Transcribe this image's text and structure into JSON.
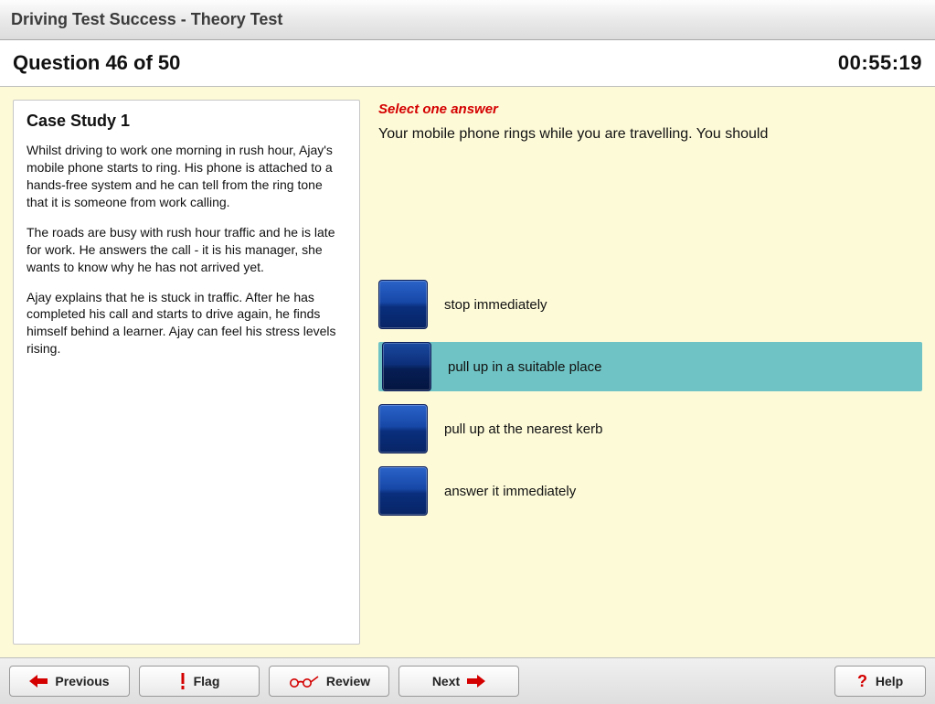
{
  "colors": {
    "accent_red": "#d40000",
    "answer_selected_bg": "#6fc3c4",
    "button_blue": "#1748a8"
  },
  "titlebar": {
    "title": "Driving Test Success - Theory Test"
  },
  "header": {
    "question_label": "Question 46 of 50",
    "timer": "00:55:19"
  },
  "case": {
    "heading": "Case Study 1",
    "paragraphs": [
      "Whilst driving to work one morning in rush hour, Ajay's mobile phone starts to ring. His phone is attached to a hands-free system and he can tell from the ring tone that it is someone from work calling.",
      "The roads are busy with rush hour traffic and he is late for work. He answers the call - it is his manager, she wants to know why he has not arrived yet.",
      "Ajay explains that he is stuck in traffic. After he has completed his call and starts to drive again, he finds himself behind a learner. Ajay can feel his stress levels rising."
    ]
  },
  "question": {
    "instruction": "Select one answer",
    "text": "Your mobile phone rings while you are travelling. You should",
    "answers": [
      {
        "text": "stop immediately",
        "selected": false
      },
      {
        "text": "pull up in a suitable place",
        "selected": true
      },
      {
        "text": "pull up at the nearest kerb",
        "selected": false
      },
      {
        "text": "answer it immediately",
        "selected": false
      }
    ]
  },
  "toolbar": {
    "previous": "Previous",
    "flag": "Flag",
    "review": "Review",
    "next": "Next",
    "help": "Help"
  }
}
